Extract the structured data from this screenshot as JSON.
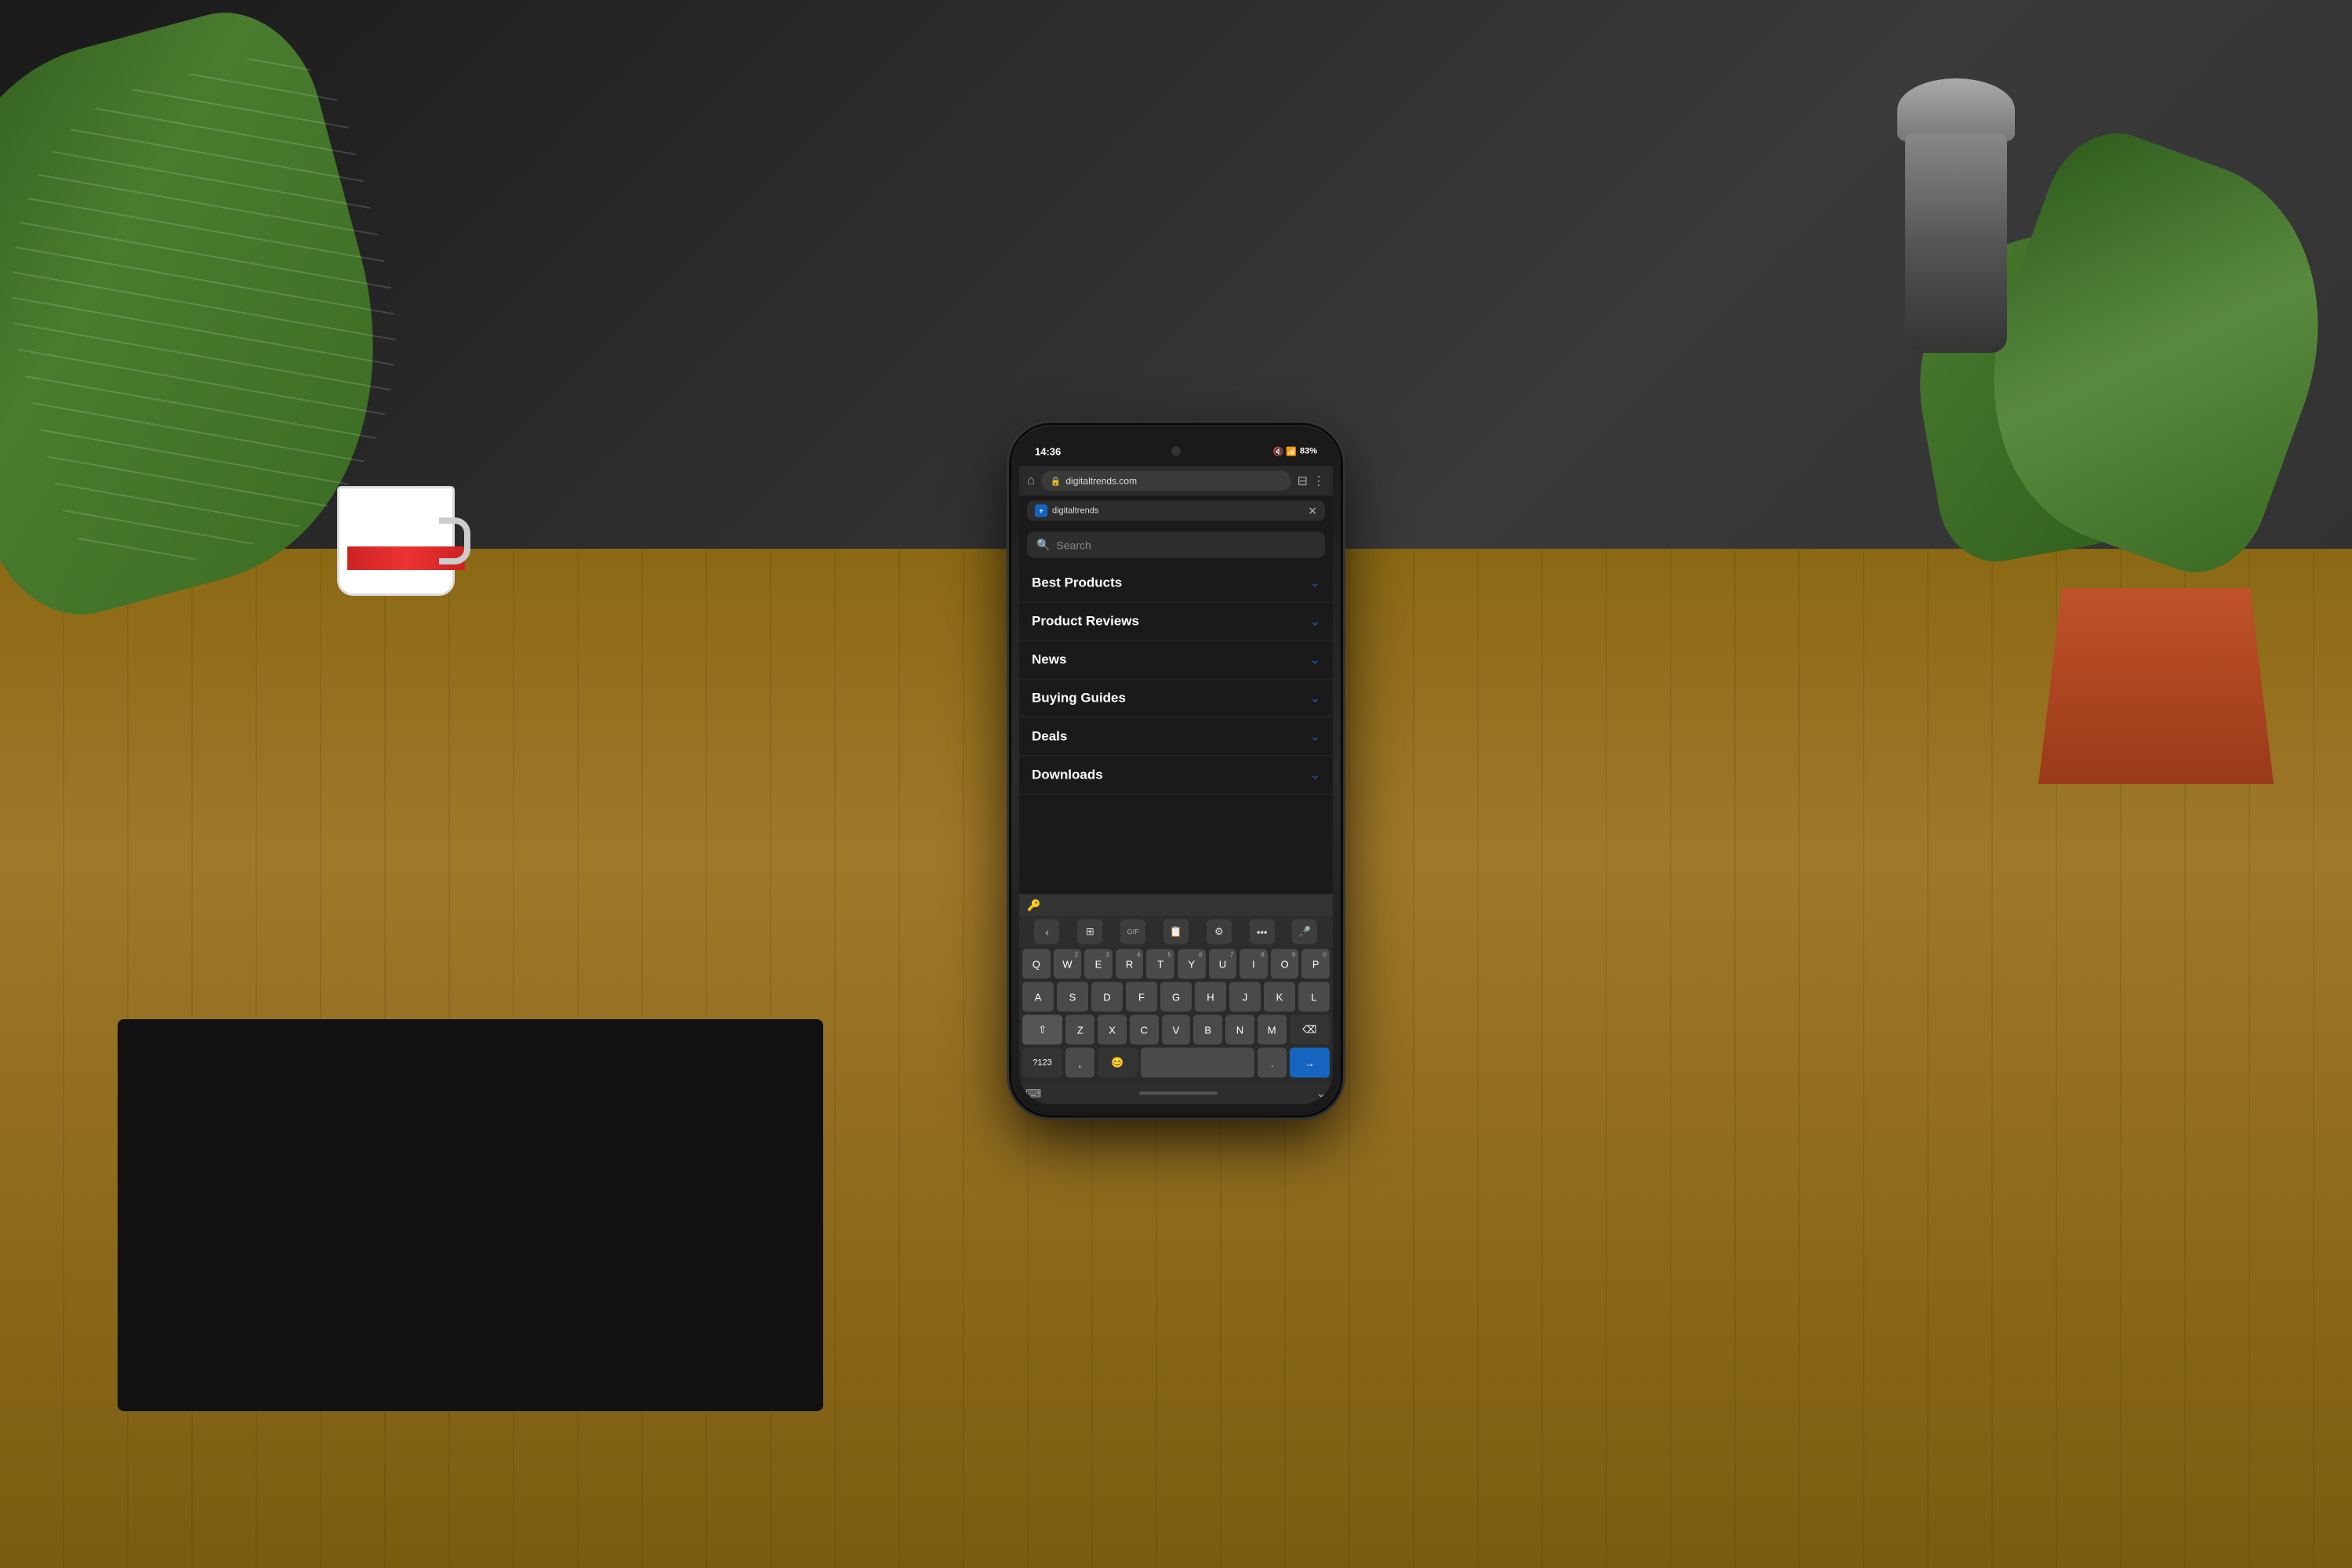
{
  "background": {
    "color": "#2a2a2a"
  },
  "status_bar": {
    "time": "14:36",
    "icons": "🔇 📶 83%",
    "battery": "83%"
  },
  "browser": {
    "url": "digitaltrends.com",
    "tab_title": "digitaltrends",
    "tab_favicon": "+",
    "home_icon": "⌂",
    "lock_icon": "🔒",
    "tabs_icon": "⊟",
    "more_icon": "⋮"
  },
  "menu": {
    "search_placeholder": "Search",
    "items": [
      {
        "label": "Best Products",
        "has_chevron": true
      },
      {
        "label": "Product Reviews",
        "has_chevron": true
      },
      {
        "label": "News",
        "has_chevron": true
      },
      {
        "label": "Buying Guides",
        "has_chevron": true
      },
      {
        "label": "Deals",
        "has_chevron": true
      },
      {
        "label": "Downloads",
        "has_chevron": true
      }
    ]
  },
  "keyboard": {
    "toolbar_icon": "🔑",
    "rows": [
      [
        "Q",
        "W",
        "E",
        "R",
        "T",
        "Y",
        "U",
        "I",
        "O",
        "P"
      ],
      [
        "A",
        "S",
        "D",
        "F",
        "G",
        "H",
        "J",
        "K",
        "L"
      ],
      [
        "Z",
        "X",
        "C",
        "V",
        "B",
        "N",
        "M"
      ]
    ],
    "superscripts": {
      "W": "2",
      "E": "3",
      "R": "4",
      "T": "5",
      "Y": "6",
      "U": "7",
      "I": "8",
      "O": "9",
      "P": "0"
    },
    "bottom_left": "?123",
    "comma": ",",
    "period": ".",
    "send_icon": "→",
    "emoji_icon": "😊"
  }
}
